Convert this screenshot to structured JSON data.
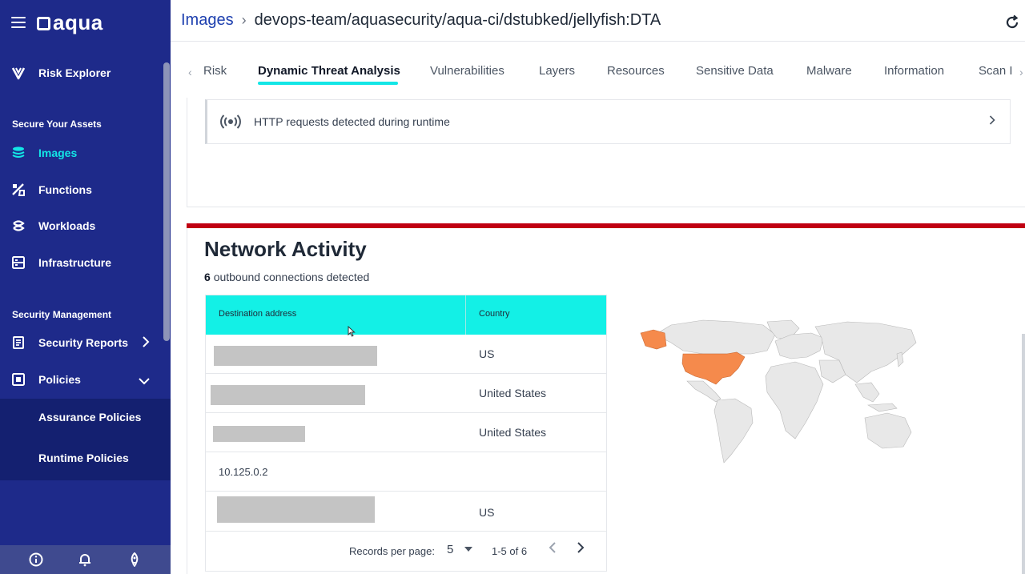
{
  "sidebar": {
    "logo": "aqua",
    "risk_explorer": "Risk Explorer",
    "section_assets": "Secure Your Assets",
    "images": "Images",
    "functions": "Functions",
    "workloads": "Workloads",
    "infrastructure": "Infrastructure",
    "section_security": "Security Management",
    "security_reports": "Security Reports",
    "policies": "Policies",
    "assurance_policies": "Assurance Policies",
    "runtime_policies": "Runtime Policies",
    "active_color": "#13e6e6",
    "bg_color": "#1e2a8a"
  },
  "header": {
    "breadcrumb_root": "Images",
    "breadcrumb_sep": "›",
    "title": "devops-team/aquasecurity/aqua-ci/dstubked/jellyfish:DTA"
  },
  "tabs": [
    {
      "label": "Risk"
    },
    {
      "label": "Dynamic Threat Analysis",
      "active": true
    },
    {
      "label": "Vulnerabilities"
    },
    {
      "label": "Layers"
    },
    {
      "label": "Resources"
    },
    {
      "label": "Sensitive Data"
    },
    {
      "label": "Malware"
    },
    {
      "label": "Information"
    },
    {
      "label": "Scan I"
    }
  ],
  "http_row": {
    "text": "HTTP requests detected during runtime"
  },
  "network": {
    "title": "Network Activity",
    "count": "6",
    "count_suffix": "outbound connections detected",
    "accent_color": "#c00012",
    "header_color": "#13f0e6",
    "columns": [
      "Destination address",
      "Country"
    ],
    "rows": [
      {
        "address": "",
        "country": "US",
        "redacted": true
      },
      {
        "address": "",
        "country": "United States",
        "redacted": true
      },
      {
        "address": "",
        "country": "United States",
        "redacted": true
      },
      {
        "address": "10.125.0.2",
        "country": "",
        "redacted": false
      },
      {
        "address": "",
        "country": "US",
        "redacted": true
      }
    ],
    "pager": {
      "label": "Records per page:",
      "per_page": "5",
      "range": "1-5 of 6"
    }
  },
  "map": {
    "highlight_country": "United States",
    "highlight_color": "#f58a4c",
    "base_color": "#e8e8e8"
  }
}
